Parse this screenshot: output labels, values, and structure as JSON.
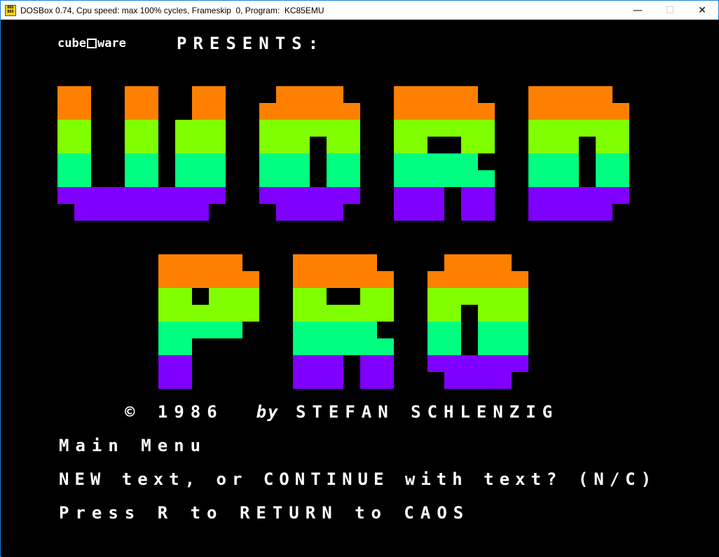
{
  "window": {
    "title": "DOSBox 0.74, Cpu speed: max 100% cycles, Frameskip  0, Program:  KC85EMU",
    "icon": "dosbox-icon",
    "icon_text": "DOS BOX",
    "minimize_symbol": "—",
    "maximize_symbol": "☐",
    "close_symbol": "✕"
  },
  "screen": {
    "brand_left": "cube",
    "brand_right": "ware",
    "presents": "PRESENTS:",
    "copyright": "© 1986",
    "by": "by",
    "author": "STEFAN SCHLENZIG",
    "menu_title": "Main Menu",
    "prompt": "NEW text, or CONTINUE with text? (N/C)",
    "return": "Press R to RETURN to CAOS"
  },
  "colors": {
    "orange": "#ff8000",
    "lime": "#80ff00",
    "green": "#00ff80",
    "violet": "#8000ff"
  }
}
